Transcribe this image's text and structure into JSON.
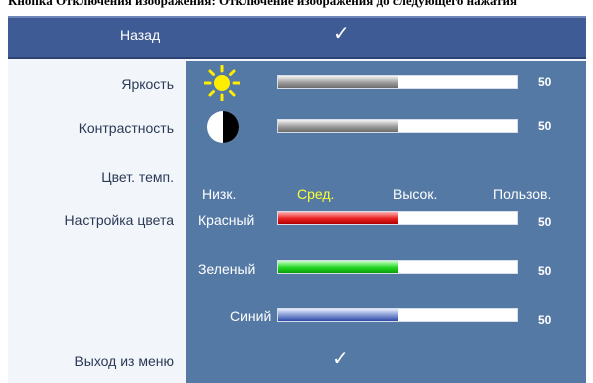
{
  "caption": "Кнопка Отключения изображения: Отключение изображения до следующего нажатия",
  "menu": {
    "back_label": "Назад",
    "exit_label": "Выход из меню",
    "check_glyph": "✓"
  },
  "rows": {
    "brightness": {
      "label": "Яркость",
      "value": "50",
      "level": 0.5,
      "icon": "sun-icon"
    },
    "contrast": {
      "label": "Контрастность",
      "value": "50",
      "level": 0.5,
      "icon": "contrast-icon"
    },
    "color_temp": {
      "label": "Цвет. темп.",
      "options": [
        "Низк.",
        "Сред.",
        "Высок.",
        "Пользов."
      ],
      "selected": "Сред."
    },
    "color_setting": {
      "label": "Настройка цвета",
      "channels": [
        {
          "label": "Красный",
          "value": "50",
          "level": 0.5,
          "color": "#e82020"
        },
        {
          "label": "Зеленый",
          "value": "50",
          "level": 0.5,
          "color": "#22d822"
        },
        {
          "label": "Синий",
          "value": "50",
          "level": 0.5,
          "color": "#3050b0"
        }
      ]
    }
  },
  "colors": {
    "header_bg": "#3f5b95",
    "panel_bg": "#5479a5",
    "selected_text": "#ffff33",
    "sun": "#ffee00"
  }
}
